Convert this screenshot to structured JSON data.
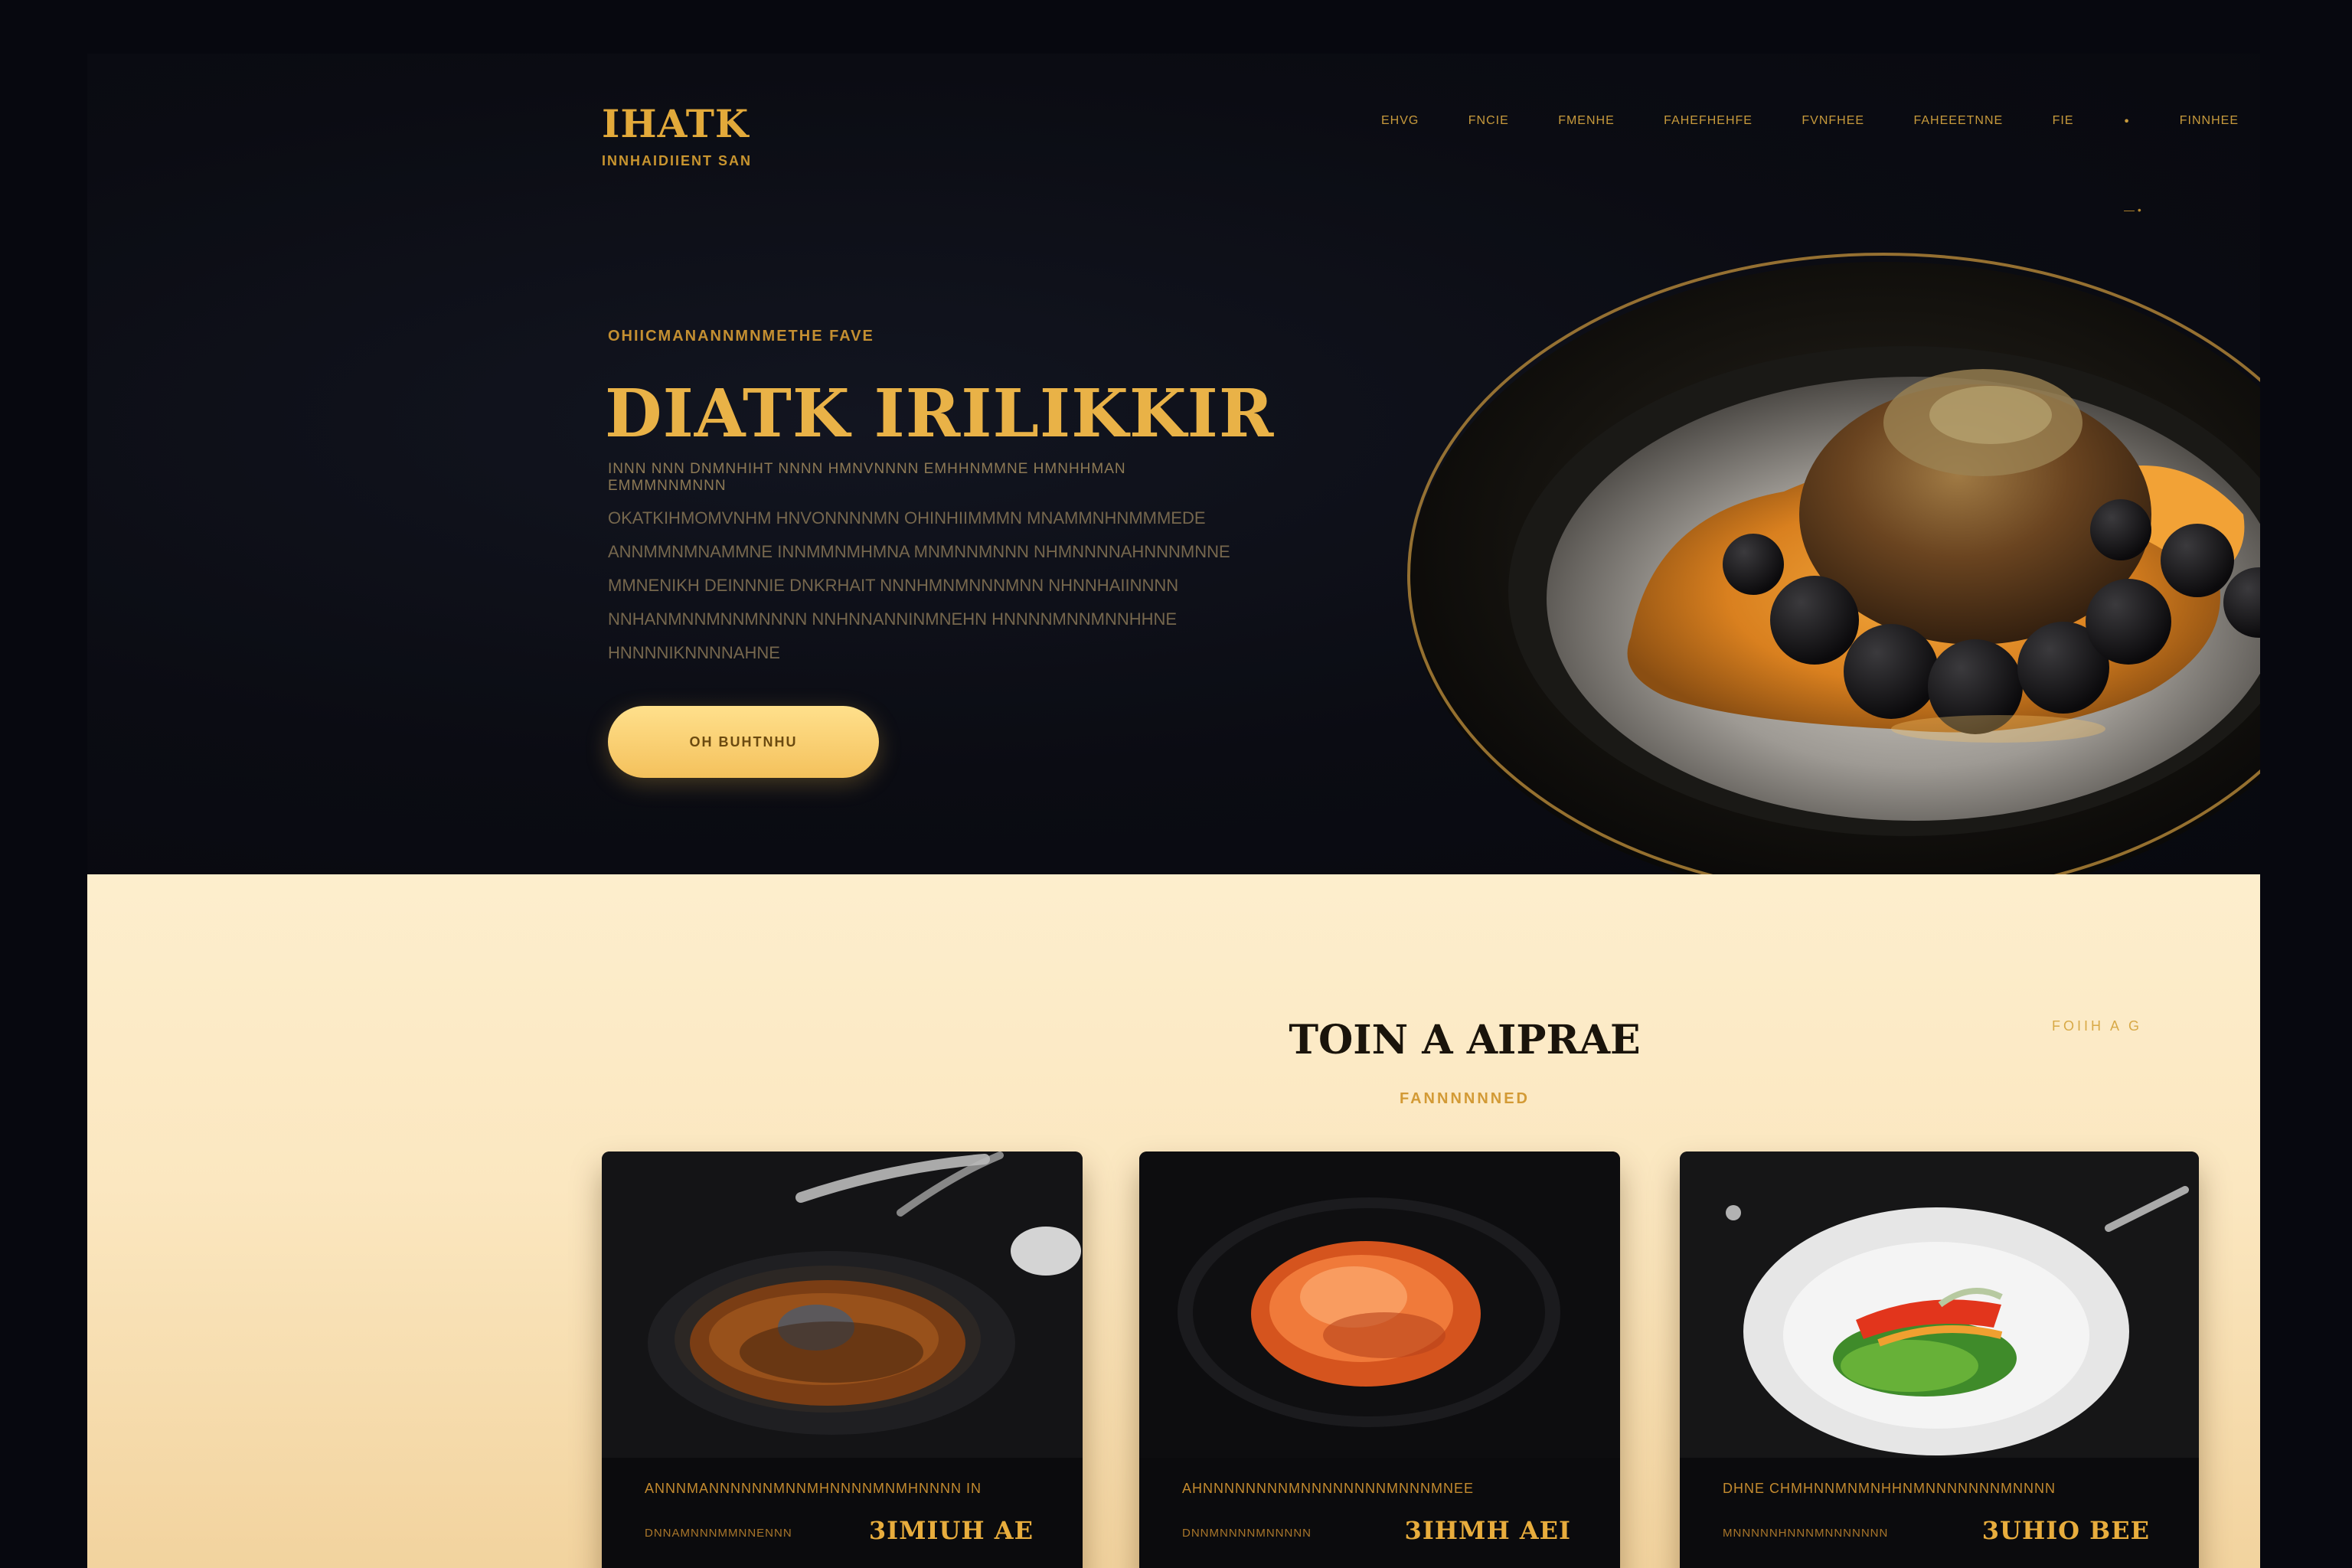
{
  "brand": {
    "title": "IHATK",
    "tagline": "INNHAIDIIENT SAN"
  },
  "nav": {
    "items": [
      "EHVG",
      "FNCIE",
      "FMENHE",
      "FAHEFHEHFE",
      "FVNFHEE",
      "FAHEEETNNE",
      "FIE",
      "•",
      "FINNHEE"
    ],
    "extra": "— •"
  },
  "hero": {
    "eyebrow": "OHIICMANANNMNMETHE FAVE",
    "title": "DIATK IRILIKKIR",
    "subtitle": "INNN NNN DNMNHIHT NNNN HMNVNNNN EMHHNMMNE HMNHHMAN EMMMNNMNNN",
    "description": "OKATKIHMOMVNHM HNVONNNNMN OHINHIIMMMN MNAMMNHNMMMEDE ANNMMNMNAMMNE INNMMNMHMNA MNMNNMNNN NHMNNNNAHNNNMNNE MMNENIKH DEINNNIE DNKRHAIT NNNHMNMNNNMNN NHNNHAIINNNN NNHANMNNMNNMNNNN NNHNNANNINMNEHN HNNNNMNNMNNHHNE HNNNNIKNNNNAHNE",
    "cta_label": "OH BUHTNHU"
  },
  "menu": {
    "title": "TOIN A AIPRAE",
    "subtitle": "FANNNNNNED",
    "link": "FOIIH A G",
    "cards": [
      {
        "description": "ANNNMANNNNNNMNNMHNNNNMNMHNNNN IN",
        "meta": "DNNAMNNNMMNNENNN",
        "price": "3IMIUH AE"
      },
      {
        "description": "AHNNNNNNNNMNNNNNNNNMNNNMNEE",
        "meta": "DNNMNNNNMNNNNN",
        "price": "3IHMH AEI"
      },
      {
        "description": "DHNE CHMHNNMNMNHHNMNNNNNNNMNNNN",
        "meta": "MNNNNNHNNNMNNNNNNN",
        "price": "3UHIO BEE"
      }
    ]
  },
  "colors": {
    "background": "#0a0b12",
    "gold": "#e9b247",
    "cta": "#f4c15c",
    "cream": "#fbe7c0"
  }
}
